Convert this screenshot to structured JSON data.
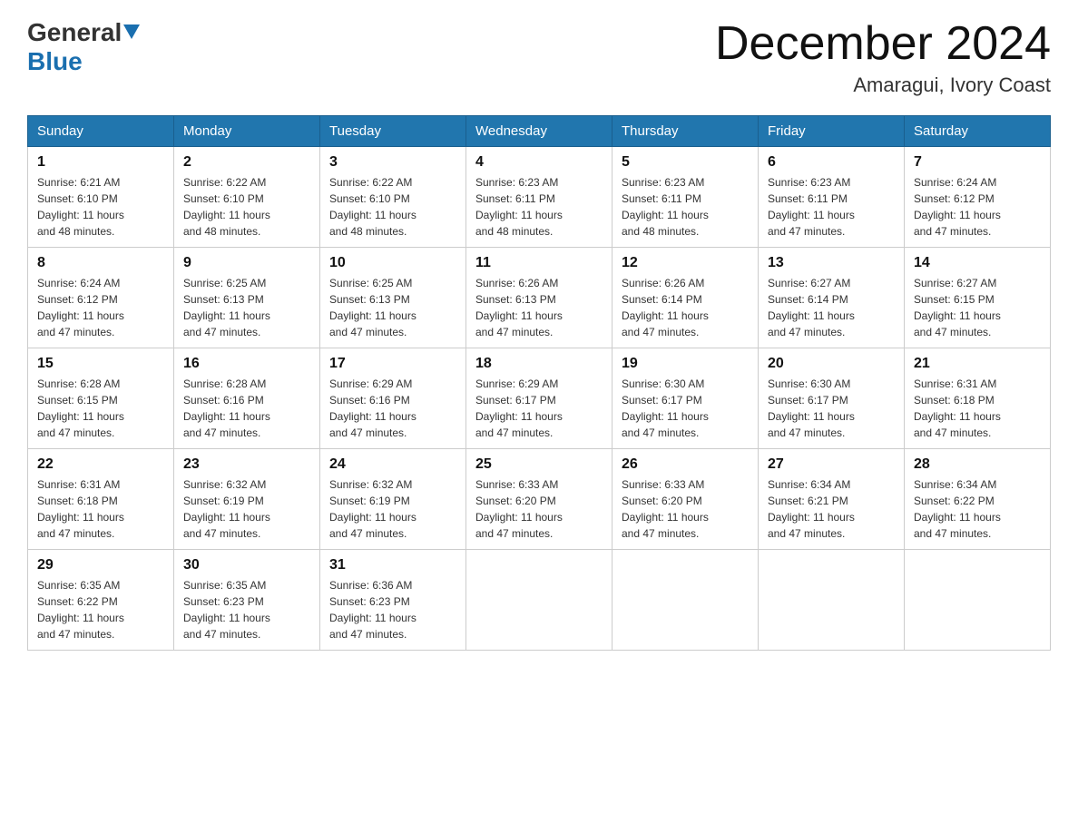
{
  "header": {
    "logo_general": "General",
    "logo_blue": "Blue",
    "month_title": "December 2024",
    "location": "Amaragui, Ivory Coast"
  },
  "weekdays": [
    "Sunday",
    "Monday",
    "Tuesday",
    "Wednesday",
    "Thursday",
    "Friday",
    "Saturday"
  ],
  "weeks": [
    [
      {
        "day": "1",
        "sunrise": "6:21 AM",
        "sunset": "6:10 PM",
        "daylight": "11 hours and 48 minutes."
      },
      {
        "day": "2",
        "sunrise": "6:22 AM",
        "sunset": "6:10 PM",
        "daylight": "11 hours and 48 minutes."
      },
      {
        "day": "3",
        "sunrise": "6:22 AM",
        "sunset": "6:10 PM",
        "daylight": "11 hours and 48 minutes."
      },
      {
        "day": "4",
        "sunrise": "6:23 AM",
        "sunset": "6:11 PM",
        "daylight": "11 hours and 48 minutes."
      },
      {
        "day": "5",
        "sunrise": "6:23 AM",
        "sunset": "6:11 PM",
        "daylight": "11 hours and 48 minutes."
      },
      {
        "day": "6",
        "sunrise": "6:23 AM",
        "sunset": "6:11 PM",
        "daylight": "11 hours and 47 minutes."
      },
      {
        "day": "7",
        "sunrise": "6:24 AM",
        "sunset": "6:12 PM",
        "daylight": "11 hours and 47 minutes."
      }
    ],
    [
      {
        "day": "8",
        "sunrise": "6:24 AM",
        "sunset": "6:12 PM",
        "daylight": "11 hours and 47 minutes."
      },
      {
        "day": "9",
        "sunrise": "6:25 AM",
        "sunset": "6:13 PM",
        "daylight": "11 hours and 47 minutes."
      },
      {
        "day": "10",
        "sunrise": "6:25 AM",
        "sunset": "6:13 PM",
        "daylight": "11 hours and 47 minutes."
      },
      {
        "day": "11",
        "sunrise": "6:26 AM",
        "sunset": "6:13 PM",
        "daylight": "11 hours and 47 minutes."
      },
      {
        "day": "12",
        "sunrise": "6:26 AM",
        "sunset": "6:14 PM",
        "daylight": "11 hours and 47 minutes."
      },
      {
        "day": "13",
        "sunrise": "6:27 AM",
        "sunset": "6:14 PM",
        "daylight": "11 hours and 47 minutes."
      },
      {
        "day": "14",
        "sunrise": "6:27 AM",
        "sunset": "6:15 PM",
        "daylight": "11 hours and 47 minutes."
      }
    ],
    [
      {
        "day": "15",
        "sunrise": "6:28 AM",
        "sunset": "6:15 PM",
        "daylight": "11 hours and 47 minutes."
      },
      {
        "day": "16",
        "sunrise": "6:28 AM",
        "sunset": "6:16 PM",
        "daylight": "11 hours and 47 minutes."
      },
      {
        "day": "17",
        "sunrise": "6:29 AM",
        "sunset": "6:16 PM",
        "daylight": "11 hours and 47 minutes."
      },
      {
        "day": "18",
        "sunrise": "6:29 AM",
        "sunset": "6:17 PM",
        "daylight": "11 hours and 47 minutes."
      },
      {
        "day": "19",
        "sunrise": "6:30 AM",
        "sunset": "6:17 PM",
        "daylight": "11 hours and 47 minutes."
      },
      {
        "day": "20",
        "sunrise": "6:30 AM",
        "sunset": "6:17 PM",
        "daylight": "11 hours and 47 minutes."
      },
      {
        "day": "21",
        "sunrise": "6:31 AM",
        "sunset": "6:18 PM",
        "daylight": "11 hours and 47 minutes."
      }
    ],
    [
      {
        "day": "22",
        "sunrise": "6:31 AM",
        "sunset": "6:18 PM",
        "daylight": "11 hours and 47 minutes."
      },
      {
        "day": "23",
        "sunrise": "6:32 AM",
        "sunset": "6:19 PM",
        "daylight": "11 hours and 47 minutes."
      },
      {
        "day": "24",
        "sunrise": "6:32 AM",
        "sunset": "6:19 PM",
        "daylight": "11 hours and 47 minutes."
      },
      {
        "day": "25",
        "sunrise": "6:33 AM",
        "sunset": "6:20 PM",
        "daylight": "11 hours and 47 minutes."
      },
      {
        "day": "26",
        "sunrise": "6:33 AM",
        "sunset": "6:20 PM",
        "daylight": "11 hours and 47 minutes."
      },
      {
        "day": "27",
        "sunrise": "6:34 AM",
        "sunset": "6:21 PM",
        "daylight": "11 hours and 47 minutes."
      },
      {
        "day": "28",
        "sunrise": "6:34 AM",
        "sunset": "6:22 PM",
        "daylight": "11 hours and 47 minutes."
      }
    ],
    [
      {
        "day": "29",
        "sunrise": "6:35 AM",
        "sunset": "6:22 PM",
        "daylight": "11 hours and 47 minutes."
      },
      {
        "day": "30",
        "sunrise": "6:35 AM",
        "sunset": "6:23 PM",
        "daylight": "11 hours and 47 minutes."
      },
      {
        "day": "31",
        "sunrise": "6:36 AM",
        "sunset": "6:23 PM",
        "daylight": "11 hours and 47 minutes."
      },
      null,
      null,
      null,
      null
    ]
  ],
  "labels": {
    "sunrise": "Sunrise:",
    "sunset": "Sunset:",
    "daylight": "Daylight:"
  }
}
